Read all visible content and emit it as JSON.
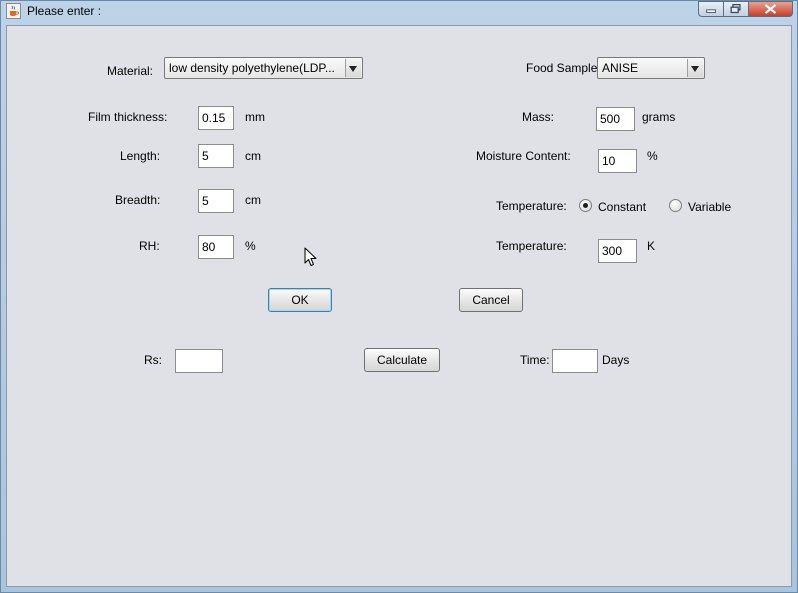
{
  "window": {
    "title": "Please enter :"
  },
  "form": {
    "material": {
      "label": "Material:",
      "value": "low density polyethylene(LDP..."
    },
    "film_thickness": {
      "label": "Film thickness:",
      "value": "0.15",
      "unit": "mm"
    },
    "length": {
      "label": "Length:",
      "value": "5",
      "unit": "cm"
    },
    "breadth": {
      "label": "Breadth:",
      "value": "5",
      "unit": "cm"
    },
    "rh": {
      "label": "RH:",
      "value": "80",
      "unit": "%"
    },
    "food_sample": {
      "label": "Food Sample:",
      "value": "ANISE"
    },
    "mass": {
      "label": "Mass:",
      "value": "500",
      "unit": "grams"
    },
    "moisture_content": {
      "label": "Moisture Content:",
      "value": "10",
      "unit": "%"
    },
    "temperature_mode": {
      "label": "Temperature:",
      "options": [
        {
          "label": "Constant",
          "checked": true
        },
        {
          "label": "Variable",
          "checked": false
        }
      ]
    },
    "temperature": {
      "label": "Temperature:",
      "value": "300",
      "unit": "K"
    }
  },
  "buttons": {
    "ok": "OK",
    "cancel": "Cancel",
    "calculate": "Calculate"
  },
  "results": {
    "rs": {
      "label": "Rs:",
      "value": ""
    },
    "time": {
      "label": "Time:",
      "value": "",
      "unit": "Days"
    }
  }
}
